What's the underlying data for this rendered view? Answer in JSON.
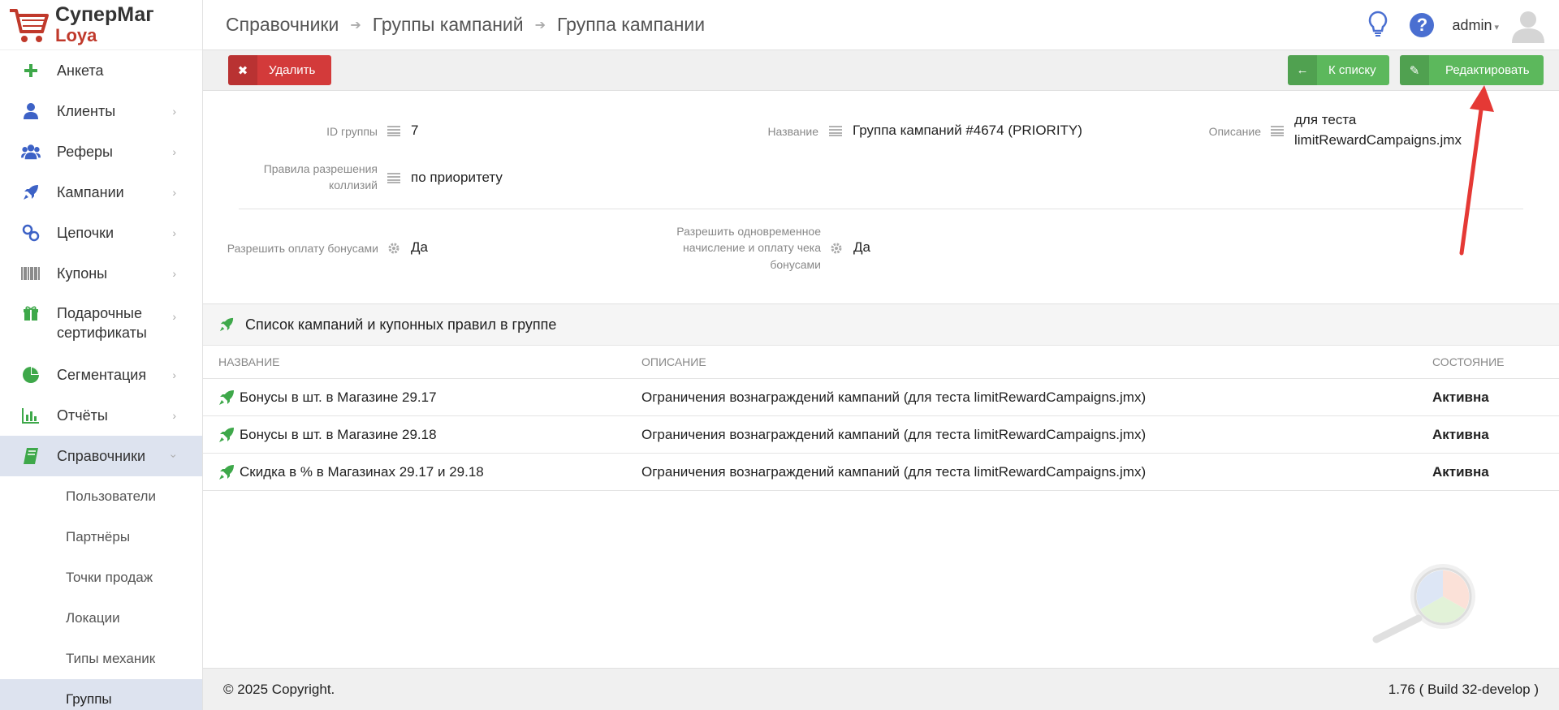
{
  "app": {
    "logo_top": "СуперМаг",
    "logo_bottom": "Loya"
  },
  "sidebar": {
    "items": [
      {
        "label": "Анкета",
        "icon": "plus-icon"
      },
      {
        "label": "Клиенты",
        "icon": "user-icon"
      },
      {
        "label": "Реферы",
        "icon": "users-icon"
      },
      {
        "label": "Кампании",
        "icon": "rocket-icon"
      },
      {
        "label": "Цепочки",
        "icon": "link-icon"
      },
      {
        "label": "Купоны",
        "icon": "barcode-icon"
      },
      {
        "label": "Подарочные сертификаты",
        "label_line1": "Подарочные",
        "label_line2": "сертификаты",
        "icon": "gift-icon"
      },
      {
        "label": "Сегментация",
        "icon": "pie-chart-icon"
      },
      {
        "label": "Отчёты",
        "icon": "bar-chart-icon"
      },
      {
        "label": "Справочники",
        "icon": "book-icon"
      }
    ],
    "sub_items": [
      {
        "label": "Пользователи"
      },
      {
        "label": "Партнёры"
      },
      {
        "label": "Точки продаж"
      },
      {
        "label": "Локации"
      },
      {
        "label": "Типы механик"
      },
      {
        "label": "Группы"
      }
    ]
  },
  "header": {
    "breadcrumbs": [
      "Справочники",
      "Группы кампаний",
      "Группа кампании"
    ],
    "help_label": "?",
    "user": "admin"
  },
  "toolbar": {
    "delete_label": "Удалить",
    "to_list_label": "К списку",
    "edit_label": "Редактировать"
  },
  "details": {
    "id_label": "ID группы",
    "id_value": "7",
    "name_label": "Название",
    "name_value": "Группа кампаний #4674 (PRIORITY)",
    "description_label": "Описание",
    "description_value_line1": "для теста",
    "description_value_line2": "limitRewardCampaigns.jmx",
    "collision_label_line1": "Правила разрешения",
    "collision_label_line2": "коллизий",
    "collision_value": "по приоритету",
    "bonus_pay_label": "Разрешить оплату бонусами",
    "bonus_pay_value": "Да",
    "simultaneous_label_line1": "Разрешить одновременное",
    "simultaneous_label_line2": "начисление и оплату чека",
    "simultaneous_label_line3": "бонусами",
    "simultaneous_value": "Да"
  },
  "campaign_list": {
    "title": "Список кампаний и купонных правил в группе",
    "columns": [
      "Название",
      "Описание",
      "Состояние"
    ],
    "rows": [
      {
        "name": "Бонусы в шт. в Магазине 29.17",
        "description": "Ограничения вознаграждений кампаний (для теста limitRewardCampaigns.jmx)",
        "state": "Активна"
      },
      {
        "name": "Бонусы в шт. в Магазине 29.18",
        "description": "Ограничения вознаграждений кампаний (для теста limitRewardCampaigns.jmx)",
        "state": "Активна"
      },
      {
        "name": "Скидка в % в Магазинах 29.17 и 29.18",
        "description": "Ограничения вознаграждений кампаний (для теста limitRewardCampaigns.jmx)",
        "state": "Активна"
      }
    ]
  },
  "footer": {
    "copyright": "© 2025 Copyright.",
    "version": "1.76 ( Build 32-develop )"
  },
  "colors": {
    "green": "#5cb85c",
    "red": "#d33a3a",
    "active_nav": "#dde3ef",
    "brand_red": "#c0392b",
    "annotation_arrow": "#e53935"
  }
}
